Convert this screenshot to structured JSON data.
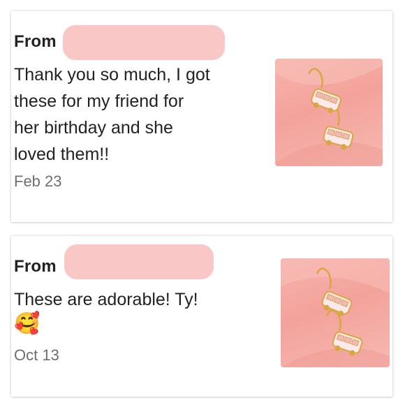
{
  "reviews": [
    {
      "from_label": "From",
      "message_lines": [
        "Thank you so much, I got",
        "these for my friend for",
        "her birthday and she",
        "loved them!!"
      ],
      "date": "Feb 23",
      "photo_icon": "pink-bus-earrings-photo"
    },
    {
      "from_label": "From",
      "message_lines": [
        "These are adorable! Ty!"
      ],
      "emoji": "🥰",
      "date": "Oct 13",
      "photo_icon": "pink-bus-earrings-photo"
    }
  ],
  "colors": {
    "redaction": "#f9c8c6",
    "photo_background": "#f3a29b",
    "text": "#222222",
    "date_text": "#6f6f6f"
  }
}
